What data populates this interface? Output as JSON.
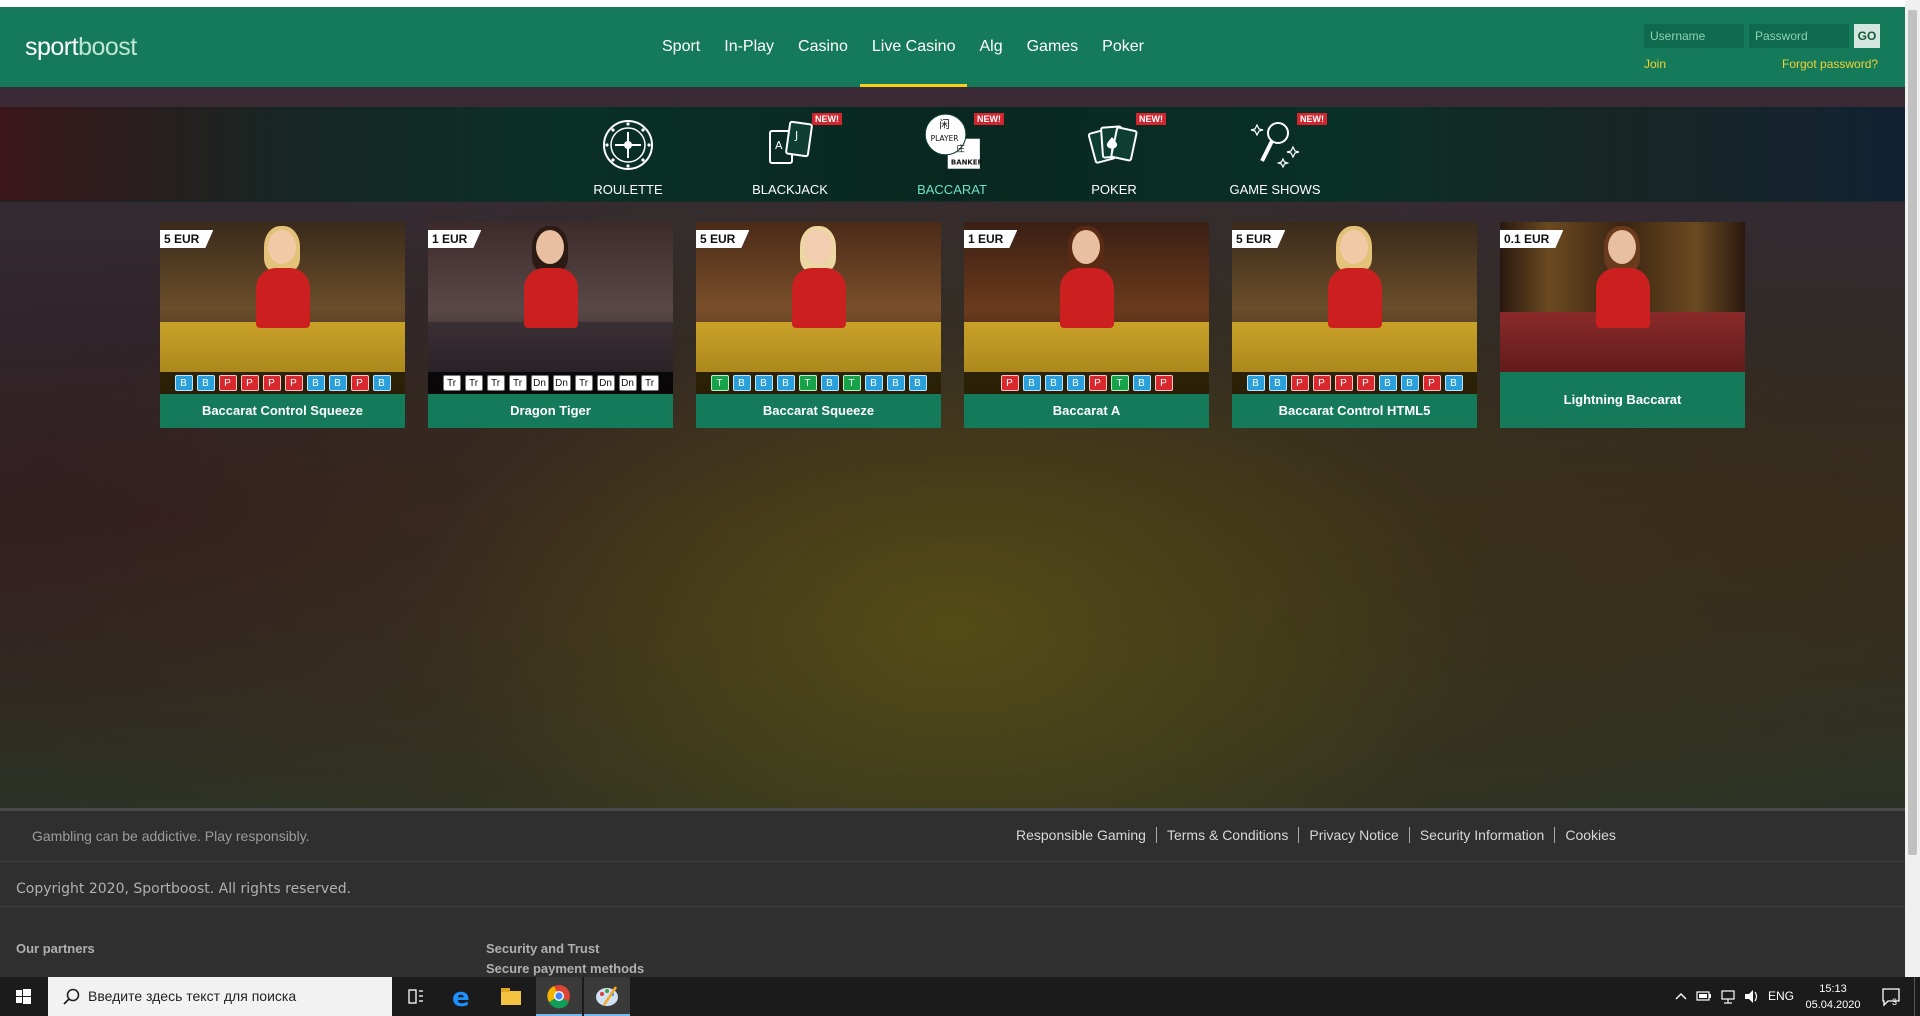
{
  "header": {
    "logo_a": "sport",
    "logo_b": "boost",
    "nav": [
      "Sport",
      "In-Play",
      "Casino",
      "Live Casino",
      "Alg",
      "Games",
      "Poker"
    ],
    "active_nav": "Live Casino",
    "username_placeholder": "Username",
    "password_placeholder": "Password",
    "go_label": "GO",
    "join_label": "Join",
    "forgot_label": "Forgot password?"
  },
  "categories": [
    {
      "label": "ROULETTE",
      "icon": "roulette-icon",
      "new": ""
    },
    {
      "label": "BLACKJACK",
      "icon": "blackjack-cards-icon",
      "new": "NEW!"
    },
    {
      "label": "BACCARAT",
      "icon": "baccarat-player-banker-icon",
      "new": "NEW!"
    },
    {
      "label": "POKER",
      "icon": "poker-cards-icon",
      "new": "NEW!"
    },
    {
      "label": "GAME SHOWS",
      "icon": "microphone-stars-icon",
      "new": "NEW!"
    }
  ],
  "tiles": [
    {
      "title": "Baccarat Control Squeeze",
      "min_bet": "5 EUR",
      "road": [
        "B",
        "B",
        "P",
        "P",
        "P",
        "P",
        "B",
        "B",
        "P",
        "B"
      ]
    },
    {
      "title": "Dragon Tiger",
      "min_bet": "1 EUR",
      "road": [
        "Tr",
        "Tr",
        "Tr",
        "Tr",
        "Dn",
        "Dn",
        "Tr",
        "Dn",
        "Dn",
        "Tr"
      ]
    },
    {
      "title": "Baccarat Squeeze",
      "min_bet": "5 EUR",
      "road": [
        "T",
        "B",
        "B",
        "B",
        "T",
        "B",
        "T",
        "B",
        "B",
        "B"
      ]
    },
    {
      "title": "Baccarat A",
      "min_bet": "1 EUR",
      "road": [
        "P",
        "B",
        "B",
        "B",
        "P",
        "T",
        "B",
        "P"
      ]
    },
    {
      "title": "Baccarat Control HTML5",
      "min_bet": "5 EUR",
      "road": [
        "B",
        "B",
        "P",
        "P",
        "P",
        "P",
        "B",
        "B",
        "P",
        "B"
      ]
    },
    {
      "title": "Lightning Baccarat",
      "min_bet": "0.1 EUR",
      "road": []
    }
  ],
  "footer": {
    "warning": "Gambling can be addictive. Play responsibly.",
    "links": [
      "Responsible Gaming",
      "Terms & Conditions",
      "Privacy Notice",
      "Security Information",
      "Cookies"
    ],
    "copyright": "Copyright 2020, Sportboost. All rights reserved.",
    "partners": "Our partners",
    "security_trust": "Security and Trust",
    "payment": "Secure payment methods"
  },
  "taskbar": {
    "search_text": "Введите здесь текст для поиска",
    "lang": "ENG",
    "time": "15:13",
    "date": "05.04.2020",
    "notification_count": "3"
  }
}
